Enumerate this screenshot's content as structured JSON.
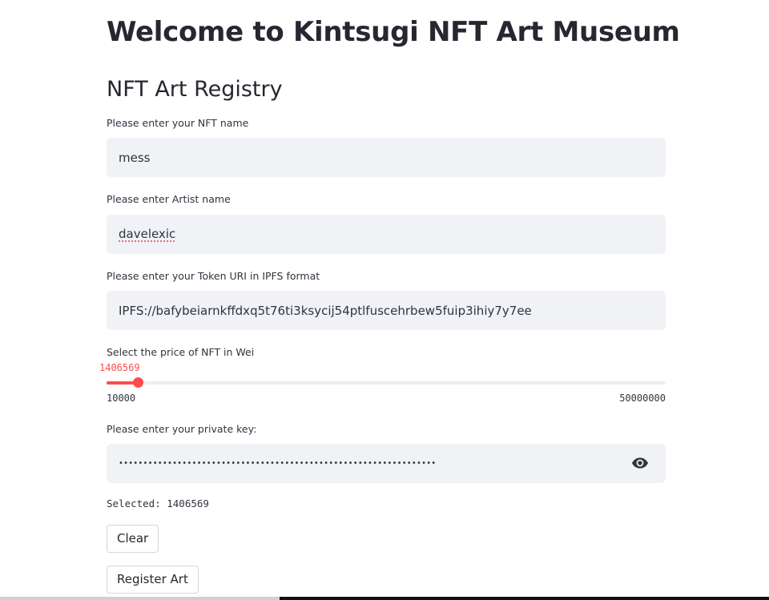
{
  "header": {
    "title": "Welcome to Kintsugi NFT Art Museum",
    "subtitle": "NFT Art Registry"
  },
  "form": {
    "nft_name": {
      "label": "Please enter your NFT name",
      "value": "mess"
    },
    "artist_name": {
      "label": "Please enter Artist name",
      "value": "davelexic"
    },
    "token_uri": {
      "label": "Please enter your Token URI in IPFS format",
      "value": "IPFS://bafybeiarnkffdxq5t76ti3ksycij54ptlfuscehrbew5fuip3ihiy7y7ee"
    },
    "price": {
      "label": "Select the price of NFT in Wei",
      "value": 1406569,
      "value_text": "1406569",
      "min": 10000,
      "max": 50000000,
      "min_text": "10000",
      "max_text": "50000000",
      "accent_color": "#ff4b4b"
    },
    "private_key": {
      "label": "Please enter your private key:",
      "masked_value": "•••••••••••••••••••••••••••••••••••••••••••••••••••••••••••••••••",
      "toggle_icon": "eye-icon"
    }
  },
  "selected_text": "Selected: 1406569",
  "buttons": {
    "clear": "Clear",
    "register": "Register Art"
  }
}
